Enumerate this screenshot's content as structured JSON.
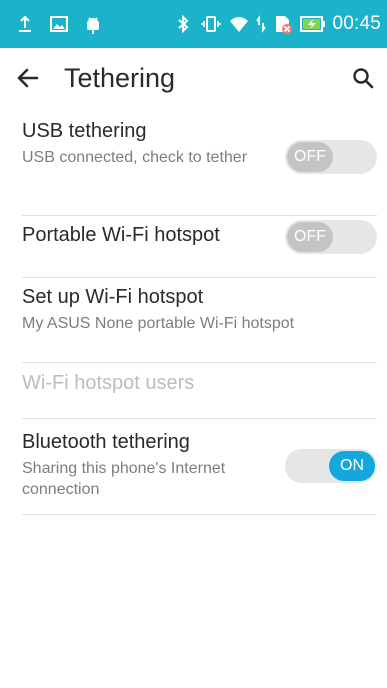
{
  "status_bar": {
    "time": "00:45",
    "left_icons": [
      "usb-debug-icon",
      "screenshot-icon",
      "android-debug-icon"
    ],
    "right_icons": [
      "bluetooth-icon",
      "vibrate-icon",
      "wifi-icon",
      "data-transfer-icon",
      "no-sim-icon",
      "battery-charging-icon"
    ]
  },
  "toolbar": {
    "title": "Tethering",
    "back_icon": "arrow-back-icon",
    "search_icon": "search-icon"
  },
  "settings": [
    {
      "title": "USB tethering",
      "summary": "USB connected, check to tether",
      "enabled": true,
      "toggle": {
        "state": "off",
        "label": "OFF"
      }
    },
    {
      "title": "Portable Wi-Fi hotspot",
      "summary": "",
      "enabled": true,
      "toggle": {
        "state": "off",
        "label": "OFF"
      }
    },
    {
      "title": "Set up Wi-Fi hotspot",
      "summary": "My ASUS None portable Wi-Fi hotspot",
      "enabled": true
    },
    {
      "title": "Wi-Fi hotspot users",
      "summary": "",
      "enabled": false
    },
    {
      "title": "Bluetooth tethering",
      "summary": "Sharing this phone's Internet connection",
      "enabled": true,
      "toggle": {
        "state": "on",
        "label": "ON"
      }
    }
  ],
  "colors": {
    "status_bar": "#1ab3c9",
    "toggle_on": "#14a7de",
    "toggle_off_knob": "#c4c4c4",
    "toggle_track": "#e6e6e6",
    "title_text": "#2a2a2a",
    "summary_text": "#7d7d7d",
    "disabled_text": "#bdbdbd"
  }
}
